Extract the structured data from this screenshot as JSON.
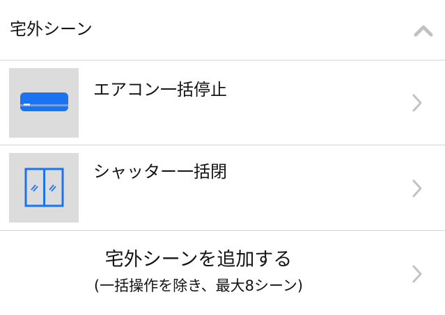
{
  "section": {
    "title": "宅外シーン",
    "collapse_icon": "chevron-up-icon"
  },
  "scenes": [
    {
      "label": "エアコン一括停止",
      "icon": "air-conditioner-icon",
      "accent": "#1a73f0",
      "thumb_bg": "#dcdcdc"
    },
    {
      "label": "シャッター一括閉",
      "icon": "window-shutter-icon",
      "accent": "#1a73f0",
      "thumb_bg": "#dcdcdc"
    }
  ],
  "add_scene": {
    "label": "宅外シーンを追加する",
    "note": "(一括操作を除き、最大8シーン)"
  },
  "colors": {
    "divider": "#d3d3d3",
    "chevron": "#c2c2c2",
    "text": "#141414"
  }
}
